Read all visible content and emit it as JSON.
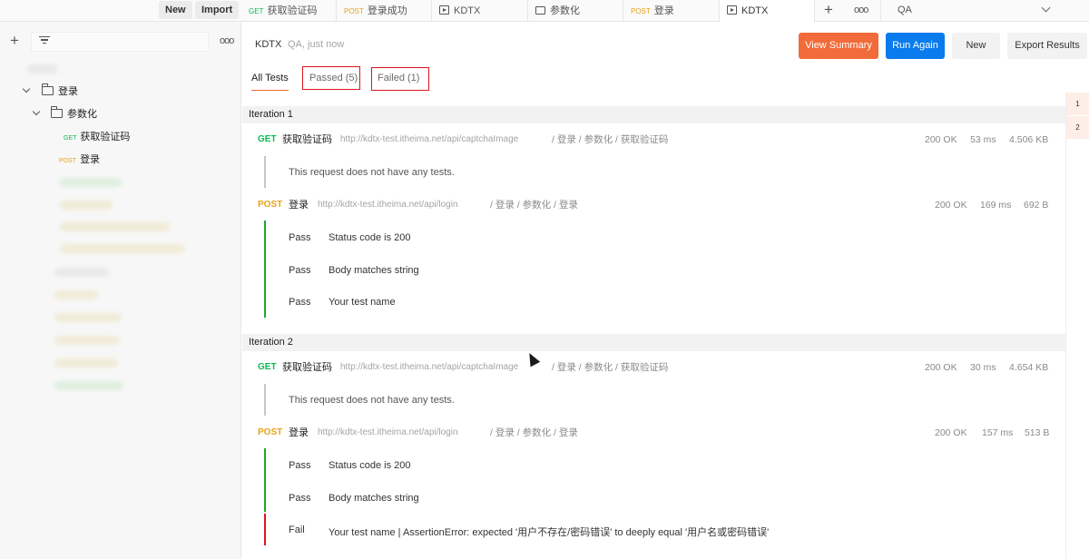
{
  "topbar": {
    "new_label": "New",
    "import_label": "Import",
    "tabs": [
      {
        "method": "GET",
        "label": "获取验证码"
      },
      {
        "method": "POST",
        "label": "登录成功"
      },
      {
        "icon": "runner-icon",
        "label": "KDTX"
      },
      {
        "icon": "folder-icon",
        "label": "参数化"
      },
      {
        "method": "POST",
        "label": "登录"
      },
      {
        "icon": "runner-icon",
        "label": "KDTX"
      }
    ],
    "environment": "QA"
  },
  "sidebar": {
    "tree": [
      {
        "type": "folder",
        "label": "登录",
        "expanded": true
      },
      {
        "type": "folder",
        "label": "参数化",
        "expanded": true
      },
      {
        "type": "request",
        "method": "GET",
        "label": "获取验证码"
      },
      {
        "type": "request",
        "method": "POST",
        "label": "登录"
      }
    ]
  },
  "run": {
    "title": "KDTX",
    "subtitle": "QA, just now",
    "buttons": {
      "view_summary": "View Summary",
      "run_again": "Run Again",
      "new": "New",
      "export": "Export Results"
    },
    "tabs": {
      "all": "All Tests",
      "passed": "Passed (5)",
      "failed": "Failed (1)"
    }
  },
  "iterations": [
    {
      "label": "Iteration 1",
      "requests": [
        {
          "method": "GET",
          "name": "获取验证码",
          "url": "http://kdtx-test.itheima.net/api/captchaImage",
          "path": "/ 登录 / 参数化 / 获取验证码",
          "status": "200 OK",
          "time": "53 ms",
          "size": "4.506 KB",
          "no_tests": "This request does not have any tests."
        },
        {
          "method": "POST",
          "name": "登录",
          "url": "http://kdtx-test.itheima.net/api/login",
          "path": "/ 登录 / 参数化 / 登录",
          "status": "200 OK",
          "time": "169 ms",
          "size": "692 B",
          "tests": [
            {
              "result": "Pass",
              "name": "Status code is 200"
            },
            {
              "result": "Pass",
              "name": "Body matches string"
            },
            {
              "result": "Pass",
              "name": "Your test name"
            }
          ]
        }
      ]
    },
    {
      "label": "Iteration 2",
      "requests": [
        {
          "method": "GET",
          "name": "获取验证码",
          "url": "http://kdtx-test.itheima.net/api/captchaImage",
          "path": "/ 登录 / 参数化 / 获取验证码",
          "status": "200 OK",
          "time": "30 ms",
          "size": "4.654 KB",
          "no_tests": "This request does not have any tests."
        },
        {
          "method": "POST",
          "name": "登录",
          "url": "http://kdtx-test.itheima.net/api/login",
          "path": "/ 登录 / 参数化 / 登录",
          "status": "200 OK",
          "time": "157 ms",
          "size": "513 B",
          "tests": [
            {
              "result": "Pass",
              "name": "Status code is 200"
            },
            {
              "result": "Pass",
              "name": "Body matches string"
            },
            {
              "result": "Fail",
              "name": "Your test name | AssertionError: expected '用户不存在/密码错误' to deeply equal '用户名或密码错误'"
            }
          ]
        }
      ]
    }
  ],
  "iteration_markers": [
    "1",
    "2"
  ],
  "colors": {
    "accent": "#f26b3a",
    "primary": "#097bed",
    "get": "#0cbb52",
    "post": "#e8a317",
    "pass": "#1fa82c",
    "fail": "#e0141e"
  }
}
